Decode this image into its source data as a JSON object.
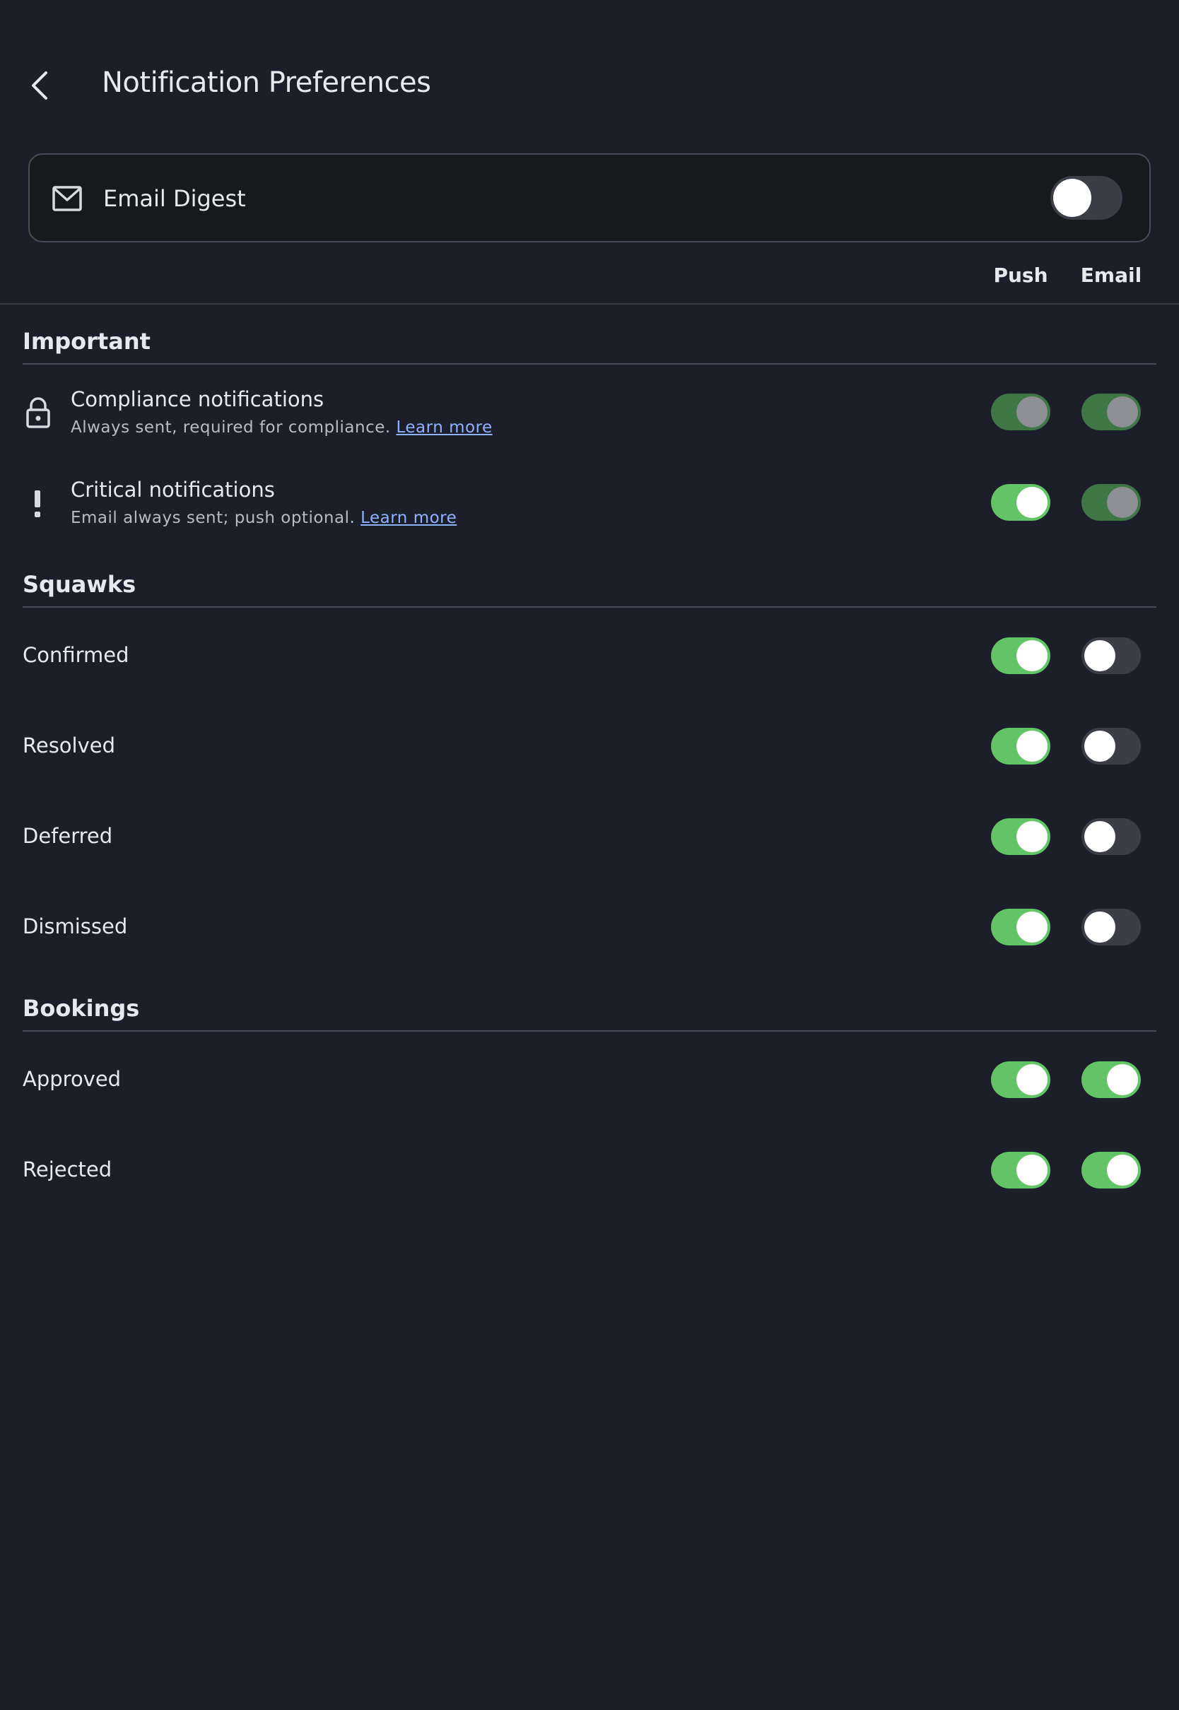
{
  "header": {
    "title": "Notification Preferences",
    "back_icon": "chevron-left-icon"
  },
  "email_digest": {
    "label": "Email Digest",
    "icon": "envelope-icon",
    "enabled": false
  },
  "columns": {
    "push": "Push",
    "email": "Email"
  },
  "sections": [
    {
      "title": "Important",
      "items": [
        {
          "title": "Compliance notifications",
          "subtitle": "Always sent, required for compliance.",
          "link": "Learn more",
          "icon": "lock-icon",
          "push": "locked",
          "email": "locked"
        },
        {
          "title": "Critical notifications",
          "subtitle": "Email always sent; push optional.",
          "link": "Learn more",
          "icon": "exclamation-icon",
          "push": "on",
          "email": "locked"
        }
      ]
    },
    {
      "title": "Squawks",
      "items": [
        {
          "title": "Confirmed",
          "push": "on",
          "email": "off"
        },
        {
          "title": "Resolved",
          "push": "on",
          "email": "off"
        },
        {
          "title": "Deferred",
          "push": "on",
          "email": "off"
        },
        {
          "title": "Dismissed",
          "push": "on",
          "email": "off"
        }
      ]
    },
    {
      "title": "Bookings",
      "items": [
        {
          "title": "Approved",
          "push": "on",
          "email": "on"
        },
        {
          "title": "Rejected",
          "push": "on",
          "email": "on"
        }
      ]
    }
  ],
  "colors": {
    "background": "#1c1f2a",
    "toggle_on": "#62c466",
    "toggle_locked": "#3f7646",
    "toggle_off": "#3b3d47",
    "link": "#8eb2ff"
  }
}
